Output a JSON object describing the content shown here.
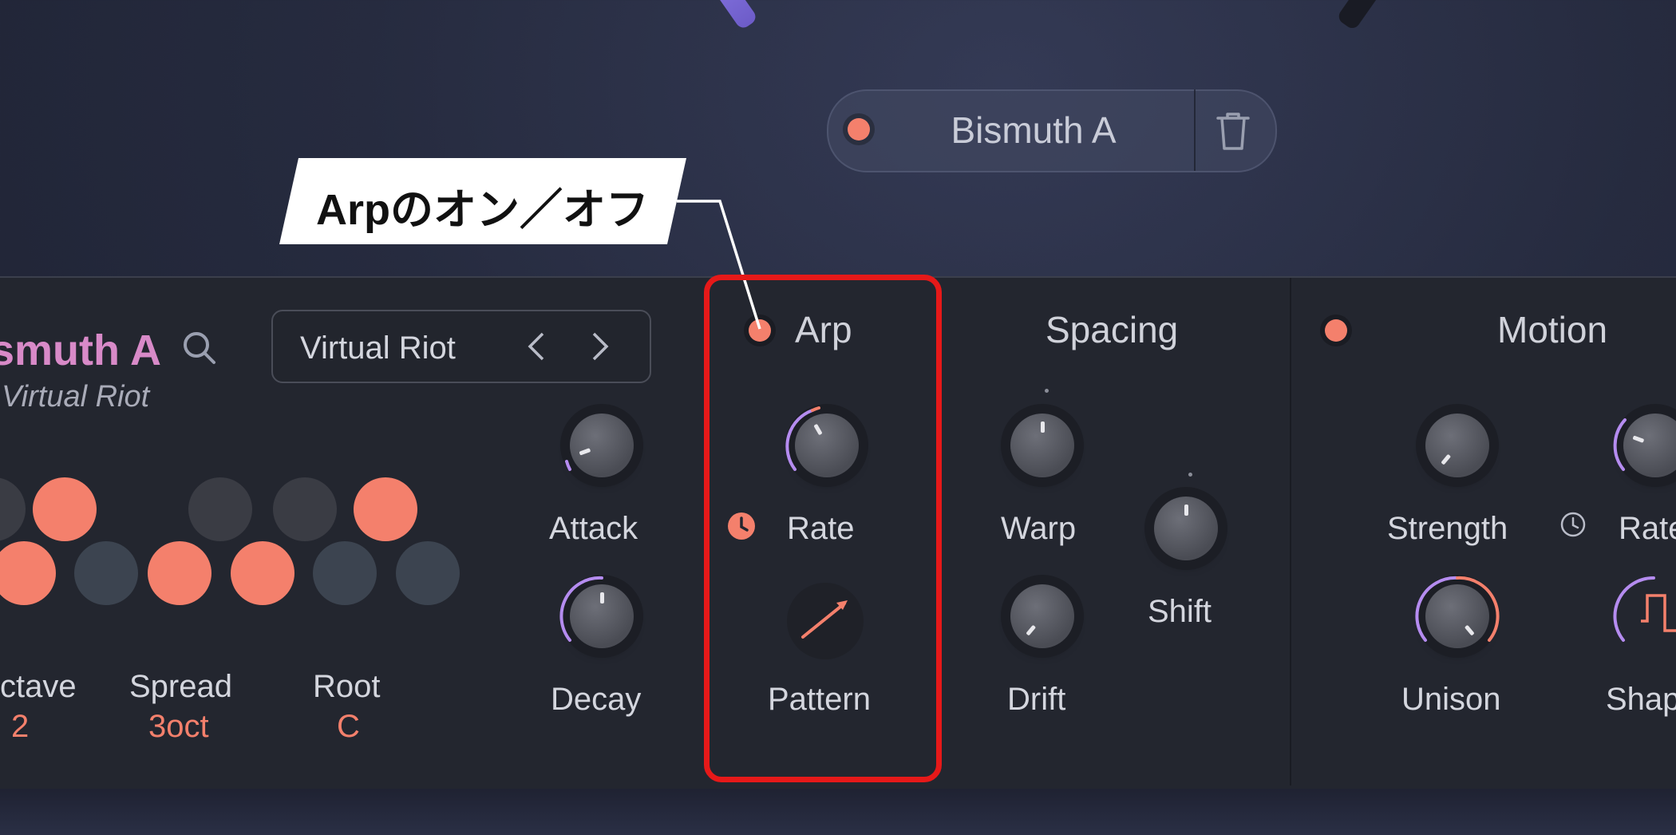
{
  "preset": {
    "name": "Bismuth A"
  },
  "callout": {
    "text": "Arpのオン／オフ"
  },
  "instrument": {
    "name": "smuth A",
    "author": "Virtual Riot",
    "author_select": "Virtual Riot",
    "params": [
      {
        "label": "ctave",
        "value": "2"
      },
      {
        "label": "Spread",
        "value": "3oct"
      },
      {
        "label": "Root",
        "value": "C"
      }
    ]
  },
  "envelope": {
    "attack_label": "Attack",
    "decay_label": "Decay"
  },
  "arp": {
    "title": "Arp",
    "rate_label": "Rate",
    "pattern_label": "Pattern"
  },
  "spacing": {
    "title": "Spacing",
    "warp_label": "Warp",
    "shift_label": "Shift",
    "drift_label": "Drift"
  },
  "motion": {
    "title": "Motion",
    "strength_label": "Strength",
    "rate_label": "Rate",
    "unison_label": "Unison",
    "shape_label": "Shap"
  },
  "colors": {
    "accent": "#f4806c",
    "highlight": "#e61919",
    "name_pink": "#d88ac8",
    "ring_purple": "#b58cf0"
  }
}
